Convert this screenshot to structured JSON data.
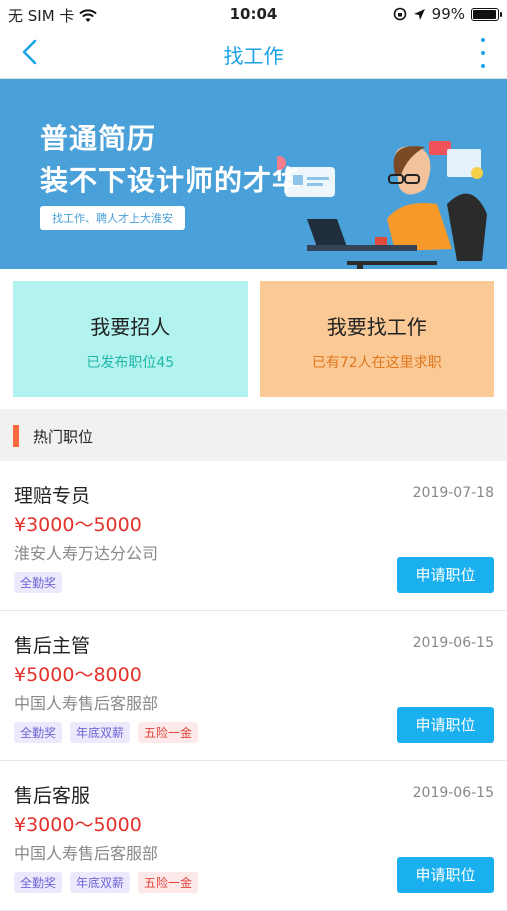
{
  "status": {
    "carrier": "无 SIM 卡",
    "time": "10:04",
    "battery": "99%"
  },
  "nav": {
    "title": "找工作"
  },
  "banner": {
    "line1": "普通简历",
    "line2": "装不下设计师的才华",
    "pill": "找工作、聘人才上大淮安"
  },
  "cards": [
    {
      "title": "我要招人",
      "sub": "已发布职位45"
    },
    {
      "title": "我要找工作",
      "sub": "已有72人在这里求职"
    }
  ],
  "section": {
    "title": "热门职位"
  },
  "jobs": [
    {
      "title": "理赔专员",
      "date": "2019-07-18",
      "salary": "¥3000～5000",
      "company": "淮安人寿万达分公司",
      "tags": [
        "全勤奖"
      ],
      "apply": "申请职位"
    },
    {
      "title": "售后主管",
      "date": "2019-06-15",
      "salary": "¥5000～8000",
      "company": "中国人寿售后客服部",
      "tags": [
        "全勤奖",
        "年底双薪",
        "五险一金"
      ],
      "apply": "申请职位"
    },
    {
      "title": "售后客服",
      "date": "2019-06-15",
      "salary": "¥3000～5000",
      "company": "中国人寿售后客服部",
      "tags": [
        "全勤奖",
        "年底双薪",
        "五险一金"
      ],
      "apply": "申请职位"
    }
  ],
  "colors": {
    "accent": "#1aa3e8",
    "salary": "#e5312b",
    "button": "#1ab0ef"
  }
}
